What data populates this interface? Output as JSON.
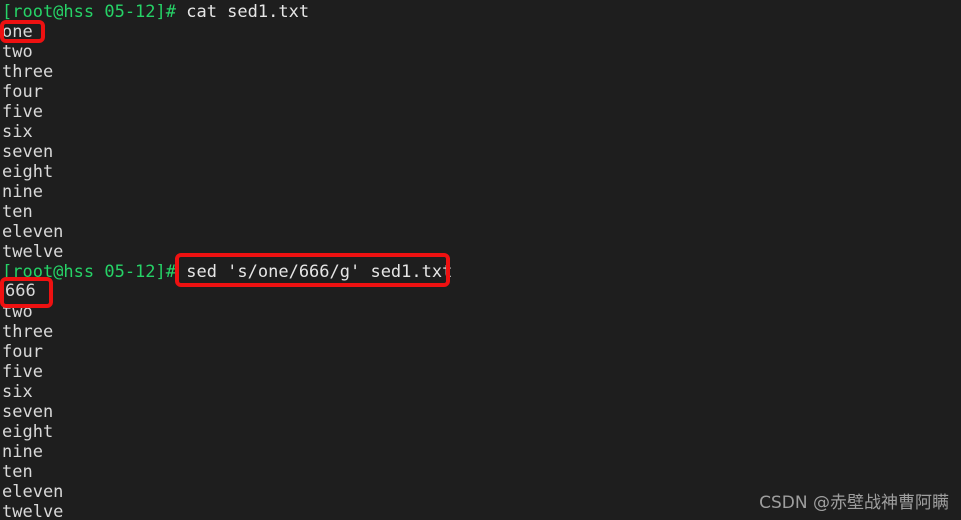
{
  "terminal": {
    "background_color": "#1e1e1e",
    "text_color": "#d9d9d9",
    "prompt_color": "#26d367",
    "highlight_color": "#ee1111",
    "lines": [
      {
        "type": "prompt",
        "prompt": "[root@hss 05-12]# ",
        "command": "cat sed1.txt"
      },
      {
        "type": "output",
        "text": "one"
      },
      {
        "type": "output",
        "text": "two"
      },
      {
        "type": "output",
        "text": "three"
      },
      {
        "type": "output",
        "text": "four"
      },
      {
        "type": "output",
        "text": "five"
      },
      {
        "type": "output",
        "text": "six"
      },
      {
        "type": "output",
        "text": "seven"
      },
      {
        "type": "output",
        "text": "eight"
      },
      {
        "type": "output",
        "text": "nine"
      },
      {
        "type": "output",
        "text": "ten"
      },
      {
        "type": "output",
        "text": "eleven"
      },
      {
        "type": "output",
        "text": "twelve"
      },
      {
        "type": "prompt",
        "prompt": "[root@hss 05-12]# ",
        "command": "sed 's/one/666/g' sed1.txt"
      },
      {
        "type": "output",
        "text": "666"
      },
      {
        "type": "output",
        "text": "two"
      },
      {
        "type": "output",
        "text": "three"
      },
      {
        "type": "output",
        "text": "four"
      },
      {
        "type": "output",
        "text": "five"
      },
      {
        "type": "output",
        "text": "six"
      },
      {
        "type": "output",
        "text": "seven"
      },
      {
        "type": "output",
        "text": "eight"
      },
      {
        "type": "output",
        "text": "nine"
      },
      {
        "type": "output",
        "text": "ten"
      },
      {
        "type": "output",
        "text": "eleven"
      },
      {
        "type": "output",
        "text": "twelve"
      }
    ]
  },
  "annotations": {
    "box_one_label": "one",
    "box_sed_label": "sed 's/one/666/g' sed1.txt",
    "box_666_label": "666"
  },
  "watermark": {
    "text": "CSDN @赤壁战神曹阿瞒"
  }
}
